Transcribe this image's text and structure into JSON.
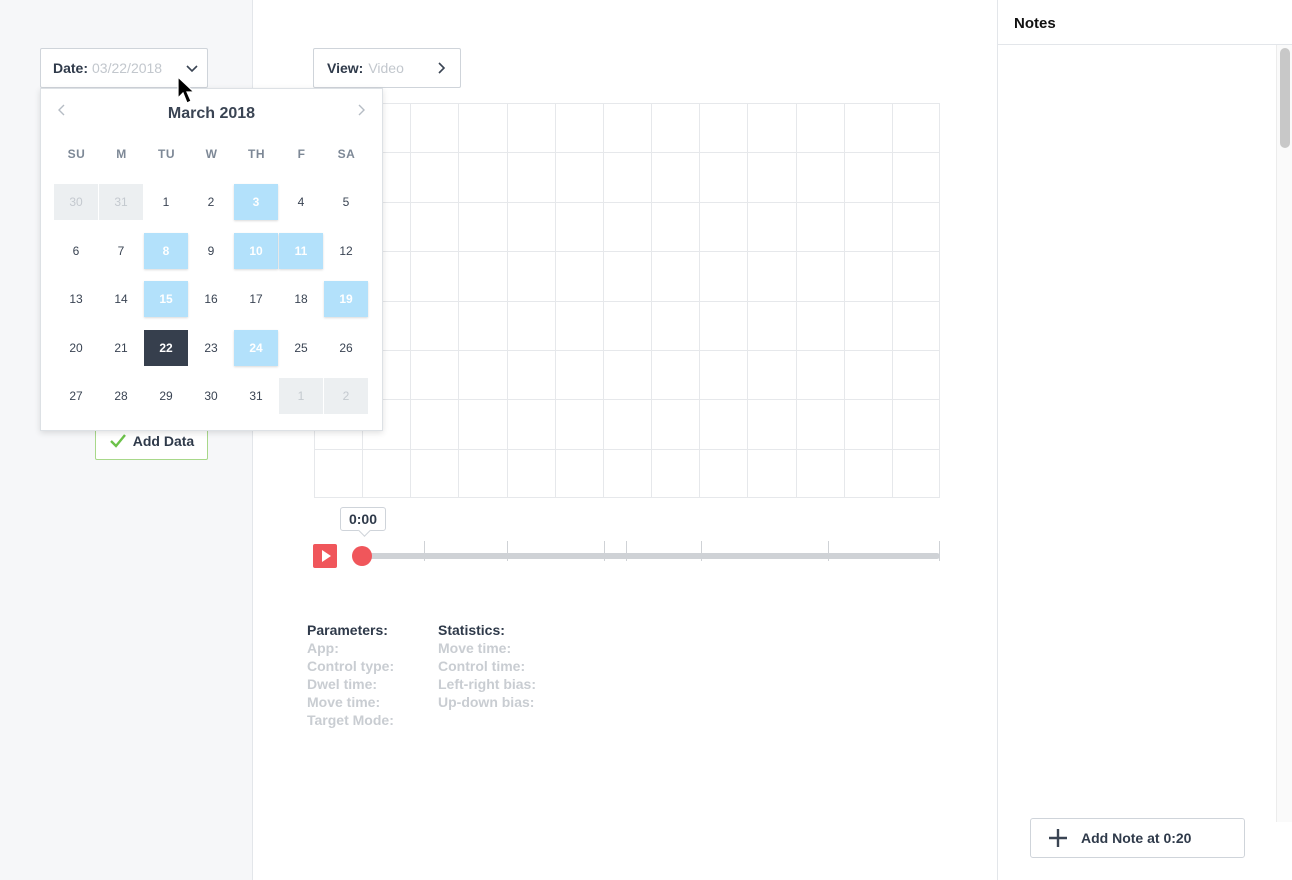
{
  "left_panel": {
    "date_select": {
      "label": "Date:",
      "value": "03/22/2018"
    },
    "add_data_label": "Add Data"
  },
  "calendar": {
    "month_title": "March 2018",
    "weekdays": [
      "SU",
      "M",
      "TU",
      "W",
      "TH",
      "F",
      "SA"
    ],
    "weeks": [
      [
        {
          "d": "30",
          "s": "other"
        },
        {
          "d": "31",
          "s": "other"
        },
        {
          "d": "1",
          "s": ""
        },
        {
          "d": "2",
          "s": ""
        },
        {
          "d": "3",
          "s": "data"
        },
        {
          "d": "4",
          "s": ""
        },
        {
          "d": "5",
          "s": ""
        }
      ],
      [
        {
          "d": "6",
          "s": ""
        },
        {
          "d": "7",
          "s": ""
        },
        {
          "d": "8",
          "s": "data"
        },
        {
          "d": "9",
          "s": ""
        },
        {
          "d": "10",
          "s": "data"
        },
        {
          "d": "11",
          "s": "data"
        },
        {
          "d": "12",
          "s": ""
        }
      ],
      [
        {
          "d": "13",
          "s": ""
        },
        {
          "d": "14",
          "s": ""
        },
        {
          "d": "15",
          "s": "data"
        },
        {
          "d": "16",
          "s": ""
        },
        {
          "d": "17",
          "s": ""
        },
        {
          "d": "18",
          "s": ""
        },
        {
          "d": "19",
          "s": "data"
        }
      ],
      [
        {
          "d": "20",
          "s": ""
        },
        {
          "d": "21",
          "s": ""
        },
        {
          "d": "22",
          "s": "selected"
        },
        {
          "d": "23",
          "s": ""
        },
        {
          "d": "24",
          "s": "data"
        },
        {
          "d": "25",
          "s": ""
        },
        {
          "d": "26",
          "s": ""
        }
      ],
      [
        {
          "d": "27",
          "s": ""
        },
        {
          "d": "28",
          "s": ""
        },
        {
          "d": "29",
          "s": ""
        },
        {
          "d": "30",
          "s": ""
        },
        {
          "d": "31",
          "s": ""
        },
        {
          "d": "1",
          "s": "other"
        },
        {
          "d": "2",
          "s": "other"
        }
      ]
    ]
  },
  "view_select": {
    "label": "View:",
    "value": "Video"
  },
  "player": {
    "time": "0:00"
  },
  "parameters": {
    "title": "Parameters:",
    "items": [
      "App:",
      "Control type:",
      "Dwel time:",
      "Move time:",
      "Target Mode:"
    ]
  },
  "statistics": {
    "title": "Statistics:",
    "items": [
      "Move time:",
      "Control time:",
      "Left-right bias:",
      "Up-down bias:"
    ]
  },
  "notes": {
    "title": "Notes",
    "add_note_label": "Add Note at 0:20"
  },
  "colors": {
    "accent_red": "#f0565b",
    "data_day": "#b3e1fb",
    "selected_day": "#363f4d",
    "add_data_border": "#a8d88a"
  }
}
